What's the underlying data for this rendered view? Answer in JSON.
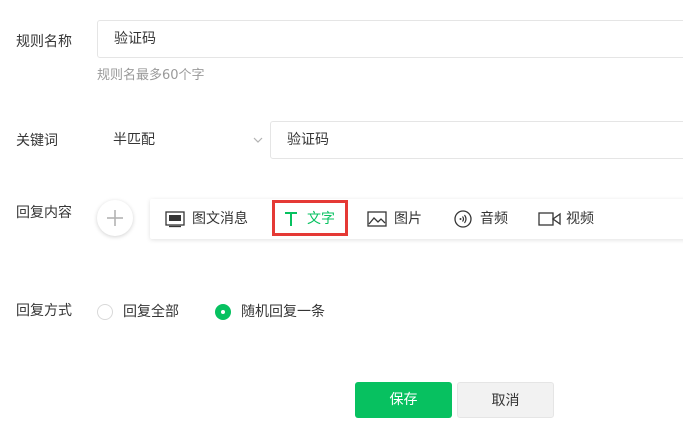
{
  "form": {
    "rule_name": {
      "label": "规则名称",
      "value": "验证码",
      "hint": "规则名最多60个字"
    },
    "keyword": {
      "label": "关键词",
      "match_mode": "半匹配",
      "value": "验证码"
    },
    "reply_content": {
      "label": "回复内容",
      "tools": [
        {
          "label": "图文消息",
          "icon": "news-icon"
        },
        {
          "label": "文字",
          "icon": "text-icon",
          "active": true
        },
        {
          "label": "图片",
          "icon": "image-icon"
        },
        {
          "label": "音频",
          "icon": "audio-icon"
        },
        {
          "label": "视频",
          "icon": "video-icon"
        }
      ]
    },
    "reply_mode": {
      "label": "回复方式",
      "options": [
        {
          "label": "回复全部",
          "selected": false
        },
        {
          "label": "随机回复一条",
          "selected": true
        }
      ]
    }
  },
  "actions": {
    "save_label": "保存",
    "cancel_label": "取消"
  },
  "colors": {
    "accent": "#07c160",
    "highlight": "#e53935"
  }
}
